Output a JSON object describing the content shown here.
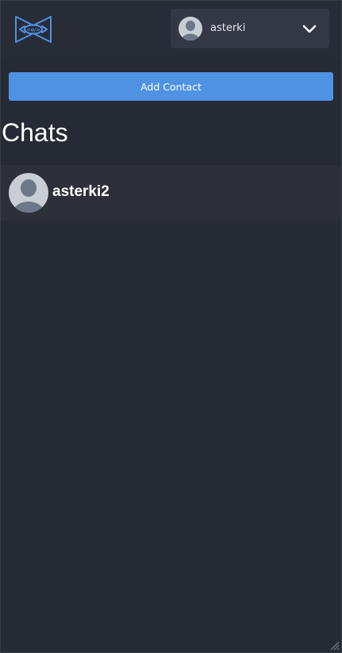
{
  "header": {
    "logo_icon": "handshake-logo-icon",
    "user_menu": {
      "username": "asterki",
      "avatar_icon": "user-avatar-icon",
      "chevron_icon": "chevron-down-icon"
    }
  },
  "actions": {
    "add_contact_label": "Add Contact"
  },
  "chats": {
    "heading": "Chats",
    "items": [
      {
        "name": "asterki2",
        "avatar_icon": "user-avatar-icon"
      }
    ]
  },
  "colors": {
    "background": "#262a35",
    "topbar": "#282c37",
    "user_menu_bg": "#343744",
    "accent": "#4f92e3",
    "chat_item_bg": "#2d303b",
    "avatar_bg": "#c9ced6",
    "avatar_figure": "#6d7787"
  }
}
